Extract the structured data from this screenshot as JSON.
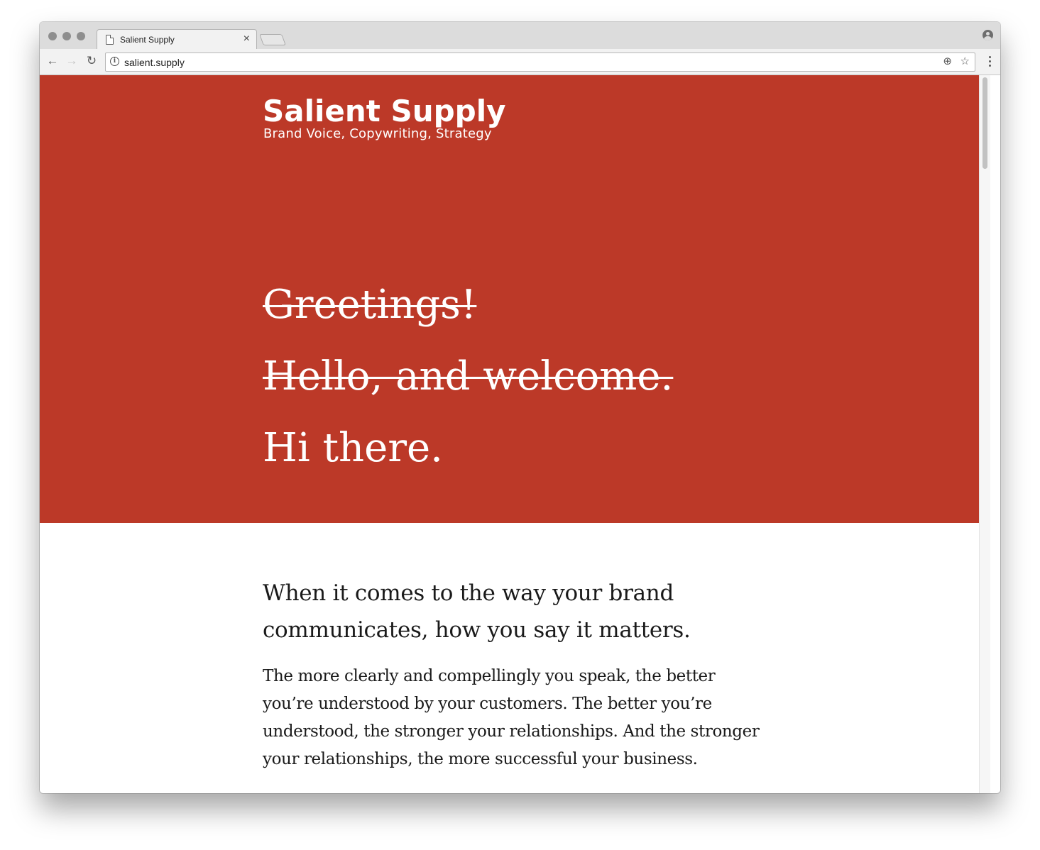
{
  "browser": {
    "tab_title": "Salient Supply",
    "tab_close": "×",
    "url": "salient.supply",
    "info_icon": "i",
    "back_icon": "←",
    "forward_icon": "→",
    "reload_icon": "↻",
    "zoom_icon": "⊕",
    "bookmark_icon": "☆"
  },
  "site": {
    "brand_name": "Salient Supply",
    "tagline": "Brand Voice, Copywriting, Strategy",
    "accent_color": "#bc3928"
  },
  "hero": {
    "greetings": [
      {
        "text": "Greetings!",
        "struck": true
      },
      {
        "text": "Hello, and welcome.",
        "struck": true
      },
      {
        "text": "Hi there.",
        "struck": false
      }
    ]
  },
  "content": {
    "lead": "When it comes to the way your brand communicates, how you say it matters.",
    "body": "The more clearly and compellingly you speak, the better you’re understood by your customers. The better you’re understood, the stronger your relationships. And the stronger your relationships, the more successful your business."
  }
}
